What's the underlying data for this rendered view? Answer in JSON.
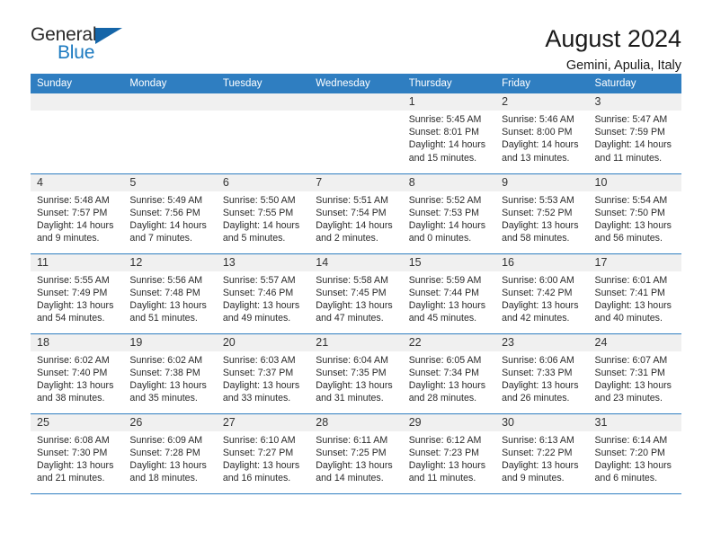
{
  "brand": {
    "name_top": "General",
    "name_bottom": "Blue",
    "logo_icon": "triangle-logo-icon",
    "accent_color": "#1c7ac0"
  },
  "header": {
    "title": "August 2024",
    "subtitle": "Gemini, Apulia, Italy"
  },
  "calendar": {
    "header_bg": "#2f7ec1",
    "daynum_bg": "#f0f0f0",
    "weekdays": [
      "Sunday",
      "Monday",
      "Tuesday",
      "Wednesday",
      "Thursday",
      "Friday",
      "Saturday"
    ],
    "weeks": [
      [
        {
          "day": "",
          "lines": []
        },
        {
          "day": "",
          "lines": []
        },
        {
          "day": "",
          "lines": []
        },
        {
          "day": "",
          "lines": []
        },
        {
          "day": "1",
          "lines": [
            "Sunrise: 5:45 AM",
            "Sunset: 8:01 PM",
            "Daylight: 14 hours",
            "and 15 minutes."
          ]
        },
        {
          "day": "2",
          "lines": [
            "Sunrise: 5:46 AM",
            "Sunset: 8:00 PM",
            "Daylight: 14 hours",
            "and 13 minutes."
          ]
        },
        {
          "day": "3",
          "lines": [
            "Sunrise: 5:47 AM",
            "Sunset: 7:59 PM",
            "Daylight: 14 hours",
            "and 11 minutes."
          ]
        }
      ],
      [
        {
          "day": "4",
          "lines": [
            "Sunrise: 5:48 AM",
            "Sunset: 7:57 PM",
            "Daylight: 14 hours",
            "and 9 minutes."
          ]
        },
        {
          "day": "5",
          "lines": [
            "Sunrise: 5:49 AM",
            "Sunset: 7:56 PM",
            "Daylight: 14 hours",
            "and 7 minutes."
          ]
        },
        {
          "day": "6",
          "lines": [
            "Sunrise: 5:50 AM",
            "Sunset: 7:55 PM",
            "Daylight: 14 hours",
            "and 5 minutes."
          ]
        },
        {
          "day": "7",
          "lines": [
            "Sunrise: 5:51 AM",
            "Sunset: 7:54 PM",
            "Daylight: 14 hours",
            "and 2 minutes."
          ]
        },
        {
          "day": "8",
          "lines": [
            "Sunrise: 5:52 AM",
            "Sunset: 7:53 PM",
            "Daylight: 14 hours",
            "and 0 minutes."
          ]
        },
        {
          "day": "9",
          "lines": [
            "Sunrise: 5:53 AM",
            "Sunset: 7:52 PM",
            "Daylight: 13 hours",
            "and 58 minutes."
          ]
        },
        {
          "day": "10",
          "lines": [
            "Sunrise: 5:54 AM",
            "Sunset: 7:50 PM",
            "Daylight: 13 hours",
            "and 56 minutes."
          ]
        }
      ],
      [
        {
          "day": "11",
          "lines": [
            "Sunrise: 5:55 AM",
            "Sunset: 7:49 PM",
            "Daylight: 13 hours",
            "and 54 minutes."
          ]
        },
        {
          "day": "12",
          "lines": [
            "Sunrise: 5:56 AM",
            "Sunset: 7:48 PM",
            "Daylight: 13 hours",
            "and 51 minutes."
          ]
        },
        {
          "day": "13",
          "lines": [
            "Sunrise: 5:57 AM",
            "Sunset: 7:46 PM",
            "Daylight: 13 hours",
            "and 49 minutes."
          ]
        },
        {
          "day": "14",
          "lines": [
            "Sunrise: 5:58 AM",
            "Sunset: 7:45 PM",
            "Daylight: 13 hours",
            "and 47 minutes."
          ]
        },
        {
          "day": "15",
          "lines": [
            "Sunrise: 5:59 AM",
            "Sunset: 7:44 PM",
            "Daylight: 13 hours",
            "and 45 minutes."
          ]
        },
        {
          "day": "16",
          "lines": [
            "Sunrise: 6:00 AM",
            "Sunset: 7:42 PM",
            "Daylight: 13 hours",
            "and 42 minutes."
          ]
        },
        {
          "day": "17",
          "lines": [
            "Sunrise: 6:01 AM",
            "Sunset: 7:41 PM",
            "Daylight: 13 hours",
            "and 40 minutes."
          ]
        }
      ],
      [
        {
          "day": "18",
          "lines": [
            "Sunrise: 6:02 AM",
            "Sunset: 7:40 PM",
            "Daylight: 13 hours",
            "and 38 minutes."
          ]
        },
        {
          "day": "19",
          "lines": [
            "Sunrise: 6:02 AM",
            "Sunset: 7:38 PM",
            "Daylight: 13 hours",
            "and 35 minutes."
          ]
        },
        {
          "day": "20",
          "lines": [
            "Sunrise: 6:03 AM",
            "Sunset: 7:37 PM",
            "Daylight: 13 hours",
            "and 33 minutes."
          ]
        },
        {
          "day": "21",
          "lines": [
            "Sunrise: 6:04 AM",
            "Sunset: 7:35 PM",
            "Daylight: 13 hours",
            "and 31 minutes."
          ]
        },
        {
          "day": "22",
          "lines": [
            "Sunrise: 6:05 AM",
            "Sunset: 7:34 PM",
            "Daylight: 13 hours",
            "and 28 minutes."
          ]
        },
        {
          "day": "23",
          "lines": [
            "Sunrise: 6:06 AM",
            "Sunset: 7:33 PM",
            "Daylight: 13 hours",
            "and 26 minutes."
          ]
        },
        {
          "day": "24",
          "lines": [
            "Sunrise: 6:07 AM",
            "Sunset: 7:31 PM",
            "Daylight: 13 hours",
            "and 23 minutes."
          ]
        }
      ],
      [
        {
          "day": "25",
          "lines": [
            "Sunrise: 6:08 AM",
            "Sunset: 7:30 PM",
            "Daylight: 13 hours",
            "and 21 minutes."
          ]
        },
        {
          "day": "26",
          "lines": [
            "Sunrise: 6:09 AM",
            "Sunset: 7:28 PM",
            "Daylight: 13 hours",
            "and 18 minutes."
          ]
        },
        {
          "day": "27",
          "lines": [
            "Sunrise: 6:10 AM",
            "Sunset: 7:27 PM",
            "Daylight: 13 hours",
            "and 16 minutes."
          ]
        },
        {
          "day": "28",
          "lines": [
            "Sunrise: 6:11 AM",
            "Sunset: 7:25 PM",
            "Daylight: 13 hours",
            "and 14 minutes."
          ]
        },
        {
          "day": "29",
          "lines": [
            "Sunrise: 6:12 AM",
            "Sunset: 7:23 PM",
            "Daylight: 13 hours",
            "and 11 minutes."
          ]
        },
        {
          "day": "30",
          "lines": [
            "Sunrise: 6:13 AM",
            "Sunset: 7:22 PM",
            "Daylight: 13 hours",
            "and 9 minutes."
          ]
        },
        {
          "day": "31",
          "lines": [
            "Sunrise: 6:14 AM",
            "Sunset: 7:20 PM",
            "Daylight: 13 hours",
            "and 6 minutes."
          ]
        }
      ]
    ]
  }
}
